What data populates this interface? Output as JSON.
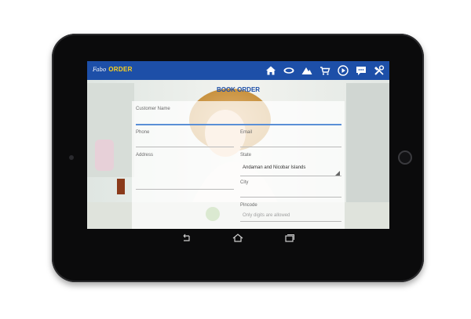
{
  "app": {
    "logo_text": "Fabo",
    "title": "ORDER"
  },
  "toolbar": {
    "icons": [
      "home-icon",
      "chat-bubble-icon",
      "mountain-icon",
      "cart-icon",
      "play-icon",
      "message-icon",
      "tools-icon"
    ]
  },
  "page": {
    "heading": "BOOK ORDER"
  },
  "form": {
    "customer_name": {
      "label": "Customer Name",
      "value": ""
    },
    "phone": {
      "label": "Phone",
      "value": ""
    },
    "email": {
      "label": "Email",
      "value": ""
    },
    "address": {
      "label": "Address",
      "value": ""
    },
    "state": {
      "label": "State",
      "value": "Andaman and Nicobar Islands"
    },
    "city": {
      "label": "City",
      "value": ""
    },
    "pincode": {
      "label": "Pincode",
      "placeholder": "Only digits are allowed"
    }
  },
  "navbar": {
    "icons": [
      "back-icon",
      "home-icon",
      "recent-apps-icon"
    ]
  },
  "colors": {
    "brand": "#1d4fa8",
    "accent": "#ffd21a"
  }
}
